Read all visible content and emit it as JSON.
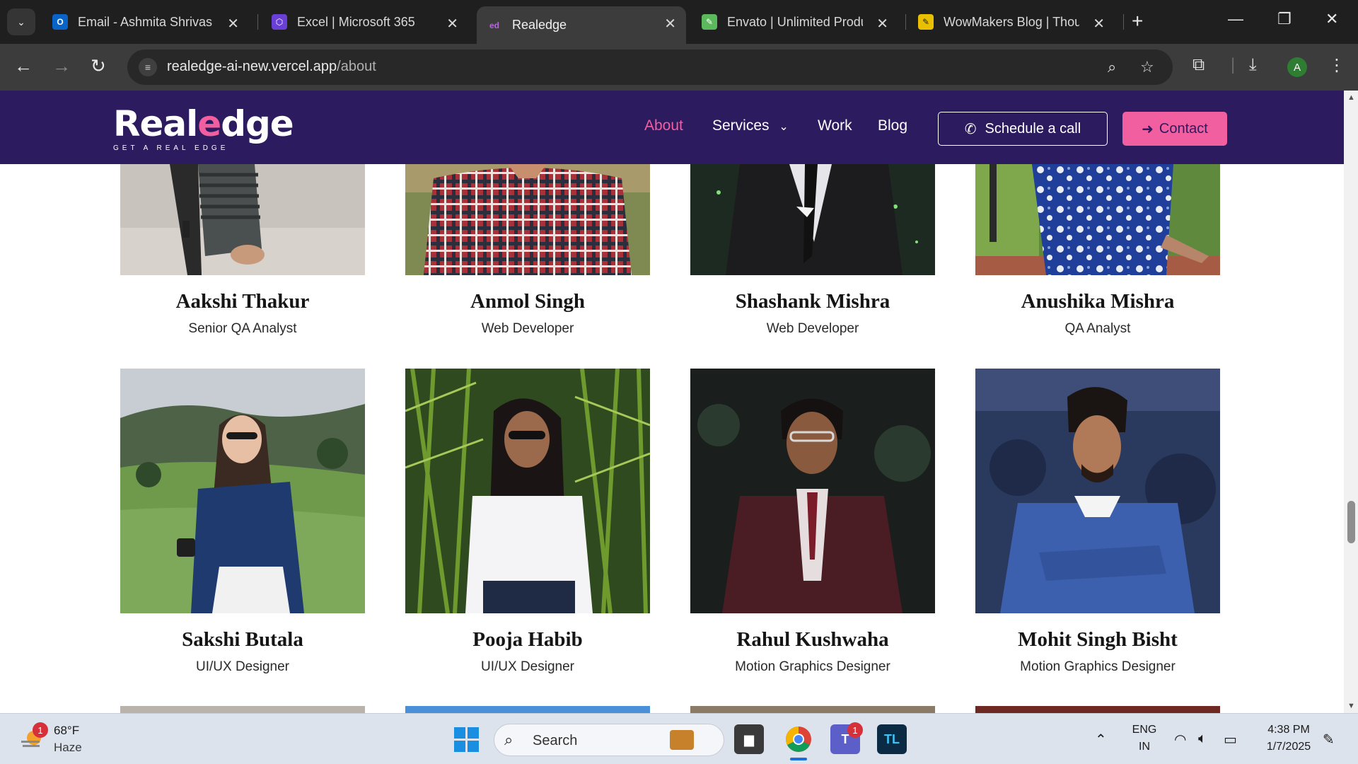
{
  "browser": {
    "tabs": [
      {
        "title": "Email - Ashmita Shrivas -",
        "icon": "outlook-icon",
        "color": "#0a64c8"
      },
      {
        "title": "Excel | Microsoft 365",
        "icon": "m365-icon",
        "color": "#6a3fd6"
      },
      {
        "title": "Realedge",
        "icon": "realedge-icon",
        "color": "#b36ad8",
        "active": true
      },
      {
        "title": "Envato | Unlimited Produ",
        "icon": "envato-icon",
        "color": "#5cb85c"
      },
      {
        "title": "WowMakers Blog | Thoug",
        "icon": "wowmakers-icon",
        "color": "#e8c000"
      }
    ],
    "url_host": "realedge-ai-new.vercel.app",
    "url_path": "/about",
    "profile_initial": "A"
  },
  "site": {
    "logo_text_a": "Real",
    "logo_text_e": "e",
    "logo_text_b": "dge",
    "logo_tagline": "GET A REAL EDGE",
    "nav": {
      "about": "About",
      "services": "Services",
      "work": "Work",
      "blog": "Blog"
    },
    "schedule_label": "Schedule a call",
    "contact_label": "Contact",
    "accent": "#f25fa0",
    "header_bg": "#2c1b5e"
  },
  "team": [
    {
      "name": "Aakshi Thakur",
      "role": "Senior QA Analyst"
    },
    {
      "name": "Anmol Singh",
      "role": "Web Developer"
    },
    {
      "name": "Shashank Mishra",
      "role": "Web Developer"
    },
    {
      "name": "Anushika Mishra",
      "role": "QA Analyst"
    },
    {
      "name": "Sakshi Butala",
      "role": "UI/UX Designer"
    },
    {
      "name": "Pooja Habib",
      "role": "UI/UX Designer"
    },
    {
      "name": "Rahul Kushwaha",
      "role": "Motion Graphics Designer"
    },
    {
      "name": "Mohit Singh Bisht",
      "role": "Motion Graphics Designer"
    }
  ],
  "taskbar": {
    "weather_temp": "68°F",
    "weather_desc": "Haze",
    "weather_badge": "1",
    "search_label": "Search",
    "teams_badge": "1",
    "lang_top": "ENG",
    "lang_bottom": "IN",
    "time": "4:38 PM",
    "date": "1/7/2025"
  }
}
